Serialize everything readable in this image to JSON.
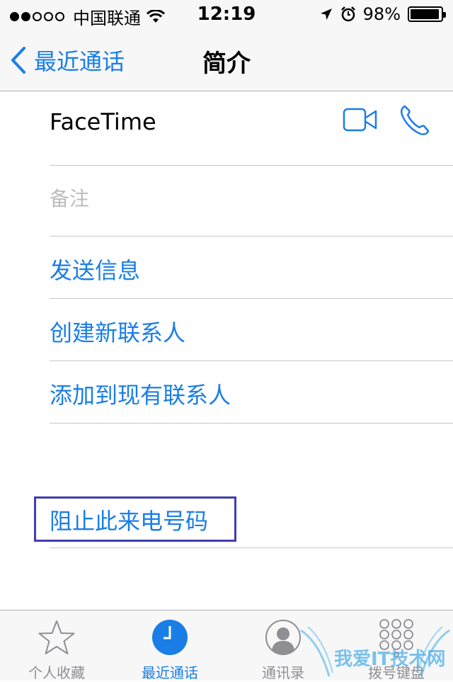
{
  "status_bar": {
    "carrier": "中国联通",
    "time": "12:19",
    "battery_percent": "98%",
    "signal_bars_filled": 2,
    "signal_bars_total": 5
  },
  "nav": {
    "back_label": "最近通话",
    "title": "简介"
  },
  "rows": {
    "facetime_label": "FaceTime",
    "notes_placeholder": "备注",
    "actions": [
      "发送信息",
      "创建新联系人",
      "添加到现有联系人"
    ],
    "block_label": "阻止此来电号码"
  },
  "tabbar": {
    "tabs": [
      {
        "label": "个人收藏",
        "icon": "star-icon",
        "active": false
      },
      {
        "label": "最近通话",
        "icon": "clock-icon",
        "active": true
      },
      {
        "label": "通讯录",
        "icon": "contacts-icon",
        "active": false
      },
      {
        "label": "拨号键盘",
        "icon": "keypad-icon",
        "active": false
      }
    ]
  },
  "watermark": {
    "text": "我爱IT技术网"
  },
  "colors": {
    "accent": "#1a7ee6",
    "highlight_border": "#3f3fb0",
    "separator": "#c8c7cc",
    "bar_background": "#f7f7f8"
  }
}
